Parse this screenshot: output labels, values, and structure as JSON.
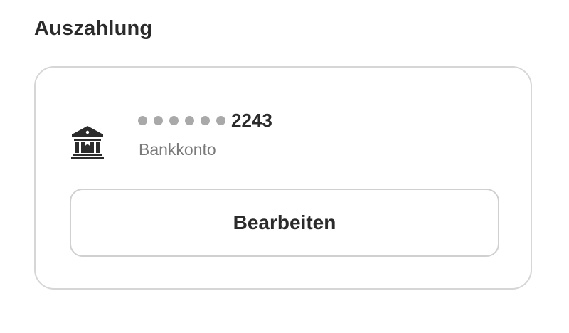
{
  "section": {
    "title": "Auszahlung"
  },
  "payout_method": {
    "icon": "bank-icon",
    "masked_dot_count": 6,
    "last4": "2243",
    "type_label": "Bankkonto"
  },
  "actions": {
    "edit_label": "Bearbeiten"
  },
  "colors": {
    "text_primary": "#2b2b2b",
    "text_secondary": "#7a7a7a",
    "mask_dot": "#a9a9a9",
    "border": "#d6d6d6"
  }
}
